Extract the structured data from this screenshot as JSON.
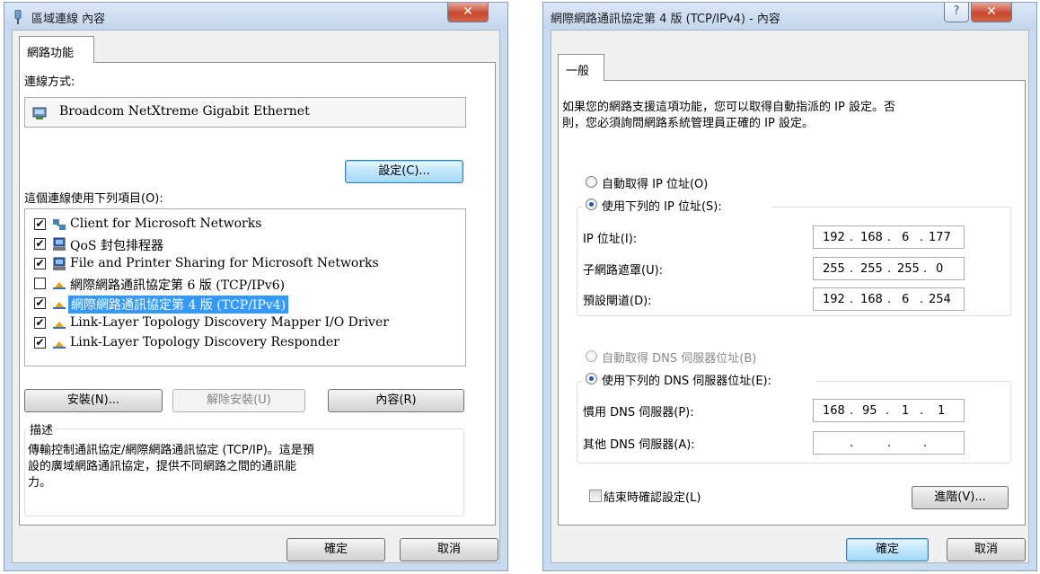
{
  "left_dialog": {
    "title": "區域連線 內容",
    "tab": "網路功能",
    "connect_using_label": "連線方式:",
    "adapter_name": "Broadcom NetXtreme Gigabit Ethernet",
    "configure_button": "設定(C)...",
    "items_label": "這個連線使用下列項目(O):",
    "items": [
      {
        "label": "Client for Microsoft Networks",
        "checked": true,
        "icon": "network-client-icon"
      },
      {
        "label": "QoS 封包排程器",
        "checked": true,
        "icon": "computer-service-icon"
      },
      {
        "label": "File and Printer Sharing for Microsoft Networks",
        "checked": true,
        "icon": "computer-service-icon"
      },
      {
        "label": "網際網路通訊協定第 6 版 (TCP/IPv6)",
        "checked": false,
        "icon": "protocol-icon"
      },
      {
        "label": "網際網路通訊協定第 4 版 (TCP/IPv4)",
        "checked": true,
        "icon": "protocol-icon",
        "selected": true
      },
      {
        "label": "Link-Layer Topology Discovery Mapper I/O Driver",
        "checked": true,
        "icon": "protocol-icon"
      },
      {
        "label": "Link-Layer Topology Discovery Responder",
        "checked": true,
        "icon": "protocol-icon"
      }
    ],
    "install_button": "安裝(N)...",
    "uninstall_button": "解除安裝(U)",
    "properties_button": "內容(R)",
    "description_title": "描述",
    "description_text": [
      "傳輸控制通訊協定/網際網路通訊協定 (TCP/IP)。這是預",
      "設的廣域網路通訊協定，提供不同網路之間的通訊能",
      "力。"
    ],
    "ok_button": "確定",
    "cancel_button": "取消"
  },
  "right_dialog": {
    "title": "網際網路通訊協定第 4 版 (TCP/IPv4) - 內容",
    "help_button": "?",
    "tab": "一般",
    "intro_text": [
      "如果您的網路支援這項功能，您可以取得自動指派的 IP 設定。否",
      "則，您必須詢問網路系統管理員正確的 IP 設定。"
    ],
    "auto_ip_label": "自動取得 IP 位址(O)",
    "manual_ip_label": "使用下列的 IP 位址(S):",
    "ip_address_label": "IP 位址(I):",
    "ip_address": [
      "192",
      "168",
      "6",
      "177"
    ],
    "subnet_label": "子網路遮罩(U):",
    "subnet": [
      "255",
      "255",
      "255",
      "0"
    ],
    "gateway_label": "預設閘道(D):",
    "gateway": [
      "192",
      "168",
      "6",
      "254"
    ],
    "auto_dns_label": "自動取得 DNS 伺服器位址(B)",
    "manual_dns_label": "使用下列的 DNS 伺服器位址(E):",
    "preferred_dns_label": "慣用 DNS 伺服器(P):",
    "preferred_dns": [
      "168",
      "95",
      "1",
      "1"
    ],
    "alternate_dns_label": "其他 DNS 伺服器(A):",
    "alternate_dns": [
      "",
      "",
      "",
      ""
    ],
    "validate_label": "結束時確認設定(L)",
    "validate_checked": false,
    "advanced_button": "進階(V)...",
    "ok_button": "確定",
    "cancel_button": "取消"
  }
}
